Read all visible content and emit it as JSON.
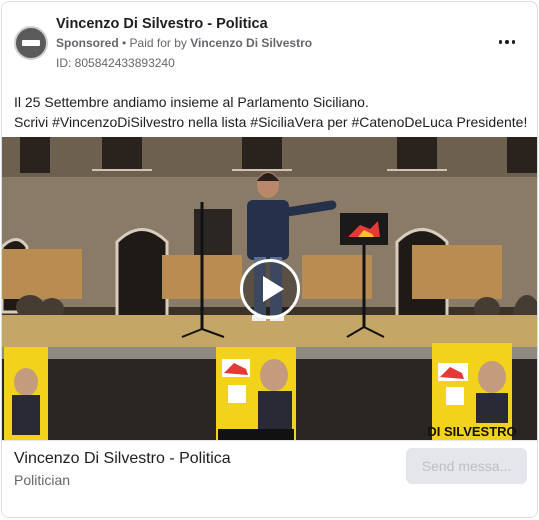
{
  "post": {
    "page_name": "Vincenzo Di Silvestro - Politica",
    "sponsored_label": "Sponsored",
    "separator": " • ",
    "paid_for_prefix": "Paid for by ",
    "paid_for_by": "Vincenzo Di Silvestro",
    "ad_id": "ID: 805842433893240",
    "text_line1": "Il 25 Settembre andiamo insieme al Parlamento Siciliano.",
    "text_line2": "Scrivi #VincenzoDiSilvestro nella lista #SiciliaVera per #CatenoDeLuca Presidente!",
    "more_icon": "more-horizontal-icon",
    "avatar_icon": "page-avatar"
  },
  "video": {
    "play_icon": "play-icon",
    "poster_name": "DI SILVESTRO"
  },
  "footer": {
    "title": "Vincenzo Di Silvestro - Politica",
    "subtitle": "Politician",
    "cta_label": "Send messa..."
  },
  "colors": {
    "text_primary": "#1c1e21",
    "text_secondary": "#65676b",
    "cta_bg": "#e4e6eb",
    "cta_text": "#bcc0c4",
    "poster_yellow": "#f2d21b"
  }
}
